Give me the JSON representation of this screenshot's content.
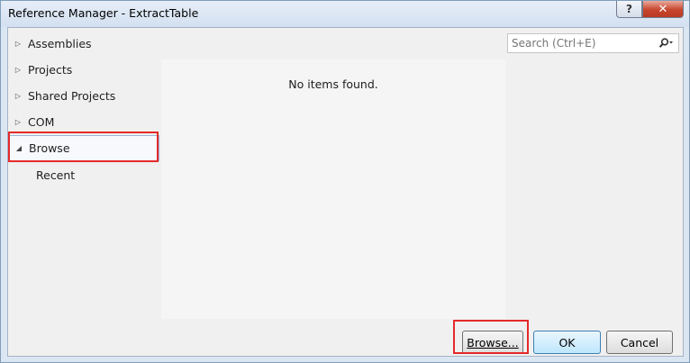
{
  "window": {
    "title": "Reference Manager - ExtractTable",
    "help_label": "?",
    "close_label": "✕"
  },
  "tree": {
    "items": [
      {
        "label": "Assemblies",
        "arrow": "▷"
      },
      {
        "label": "Projects",
        "arrow": "▷"
      },
      {
        "label": "Shared Projects",
        "arrow": "▷"
      },
      {
        "label": "COM",
        "arrow": "▷"
      },
      {
        "label": "Browse",
        "arrow": "◢",
        "selected": true
      }
    ],
    "sub_items": [
      {
        "label": "Recent"
      }
    ]
  },
  "main": {
    "empty_message": "No items found."
  },
  "search": {
    "placeholder": "Search (Ctrl+E)",
    "icon": "search-icon"
  },
  "footer": {
    "browse_label": "Browse...",
    "ok_label": "OK",
    "cancel_label": "Cancel"
  },
  "colors": {
    "highlight_box": "#e52a2a",
    "close_button": "#c7452d",
    "ok_button_border": "#3c7fb1"
  }
}
